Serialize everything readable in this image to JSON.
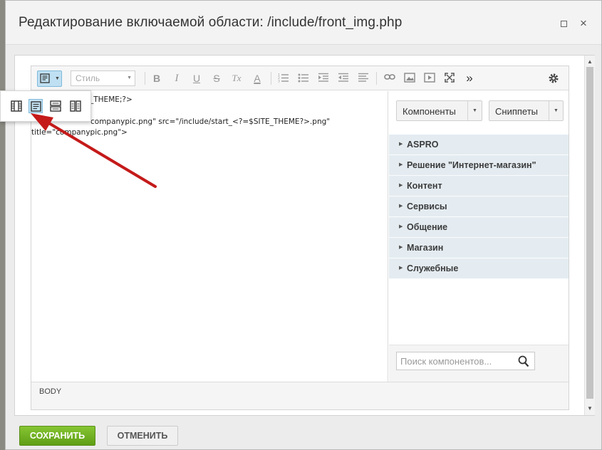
{
  "dialog": {
    "title": "Редактирование включаемой области: /include/front_img.php",
    "max_glyph": "",
    "close_glyph": "×"
  },
  "toolbar": {
    "style_placeholder": "Стиль",
    "bold": "B",
    "italic": "I",
    "underline": "U",
    "strike": "S",
    "remove_format": "Tx",
    "font_color": "A",
    "more": "»",
    "icons": [
      "view-mode-icon",
      "ordered-list-icon",
      "bullet-list-icon",
      "indent-icon",
      "outdent-icon",
      "align-icon",
      "link-icon",
      "image-icon",
      "video-icon",
      "fullscreen-icon",
      "more-icon",
      "settings-icon"
    ]
  },
  "code": {
    "line1": "_THEME;?>",
    "line2": "companypic.png\" src=\"/include/start_<?=$SITE_THEME?>.png\"",
    "line3": "title=\"companypic.png\">"
  },
  "side": {
    "components_label": "Компоненты",
    "snippets_label": "Сниппеты",
    "categories": [
      "ASPRO",
      "Решение \"Интернет-магазин\"",
      "Контент",
      "Сервисы",
      "Общение",
      "Магазин",
      "Служебные"
    ],
    "search_placeholder": "Поиск компонентов..."
  },
  "status": {
    "tag": "BODY"
  },
  "buttons": {
    "save": "СОХРАНИТЬ",
    "cancel": "ОТМЕНИТЬ"
  },
  "colors": {
    "accent": "#6eae1f",
    "arrow": "#c41a1a",
    "mode_active": "#c5e4f5"
  }
}
